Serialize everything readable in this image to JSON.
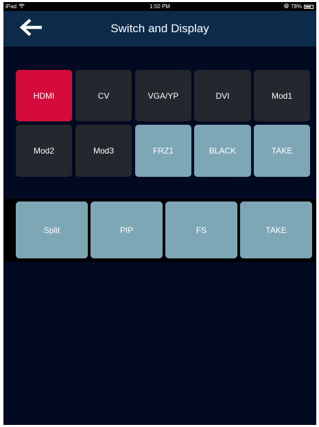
{
  "status_bar": {
    "device": "iPad",
    "wifi_icon": "wifi-icon",
    "time": "1:50 PM",
    "rotation_icon": "rotation-lock-icon",
    "battery": "78%",
    "battery_level": 0.78
  },
  "nav": {
    "back_icon": "arrow-left-icon",
    "title": "Switch and Display"
  },
  "inputs": {
    "row1": [
      "HDMI",
      "CV",
      "VGA/YP",
      "DVI",
      "Mod1"
    ],
    "row2": [
      "Mod2",
      "Mod3",
      "FRZ1",
      "BLACK",
      "TAKE"
    ]
  },
  "display_modes": [
    "Split",
    "PIP",
    "FS",
    "TAKE"
  ],
  "colors": {
    "background": "#020a22",
    "nav_bar": "#0c2b4a",
    "selected": "#d50c3b",
    "default_button": "#24272d",
    "action_button": "#7ea7b6"
  }
}
